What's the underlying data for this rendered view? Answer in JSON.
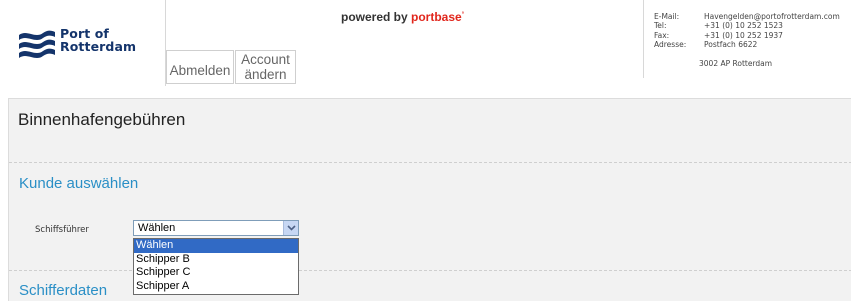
{
  "header": {
    "logo_text": [
      "Port of",
      "Rotterdam"
    ],
    "powered_prefix": "powered by ",
    "powered_brand": "portbase",
    "nav": {
      "logout": "Abmelden",
      "account_line1": "Account",
      "account_line2": "ändern"
    },
    "contact": {
      "email_label": "E-Mail:",
      "email": "Havengelden@portofrotterdam.com",
      "tel_label": "Tel:",
      "tel": "+31 (0) 10 252 1523",
      "fax_label": "Fax:",
      "fax": "+31 (0) 10 252 1937",
      "address_label": "Adresse:",
      "address_line1": "Postfach 6622",
      "address_line2": "3002 AP  Rotterdam"
    }
  },
  "main": {
    "page_title": "Binnenhafengebühren",
    "section1_title": "Kunde auswählen",
    "field_label": "Schiffsführer",
    "select": {
      "value": "Wählen",
      "options": [
        "Wählen",
        "Schipper B",
        "Schipper C",
        "Schipper A"
      ]
    },
    "section2_title": "Schifferdaten"
  },
  "colors": {
    "brand_navy": "#14346b",
    "accent_blue": "#2a8fc6",
    "brand_red": "#e1261c",
    "selection": "#316ac5"
  },
  "icons": {
    "logo": "port-of-rotterdam-logo",
    "dropdown": "chevron-down-icon"
  }
}
